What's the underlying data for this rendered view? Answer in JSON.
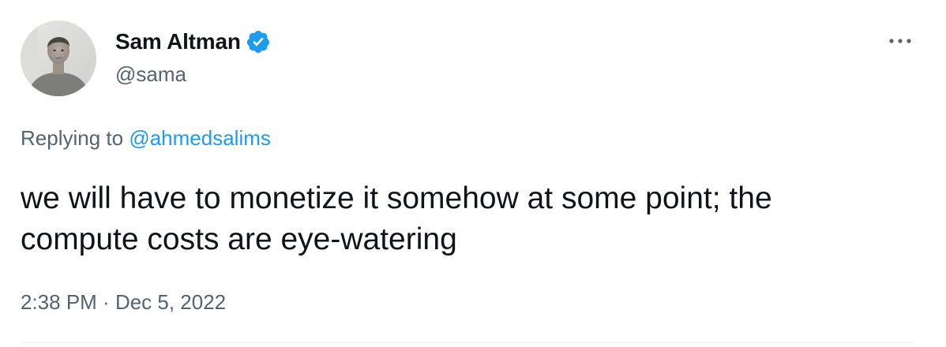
{
  "tweet": {
    "author": {
      "name": "Sam Altman",
      "handle": "@sama",
      "verified": true,
      "avatar_icon": "profile-photo"
    },
    "reply_context": {
      "prefix": "Replying to ",
      "mention": "@ahmedsalims"
    },
    "text_lines": [
      "we will have to monetize it somehow at some point; the",
      "compute costs are eye-watering"
    ],
    "time": "2:38 PM",
    "separator": " · ",
    "date": "Dec 5, 2022",
    "more_icon": "more-horizontal-icon"
  },
  "colors": {
    "text_primary": "#0f1419",
    "text_secondary": "#536471",
    "link": "#1d9bf0",
    "verified_badge": "#1d9bf0",
    "divider": "#eff3f4"
  }
}
